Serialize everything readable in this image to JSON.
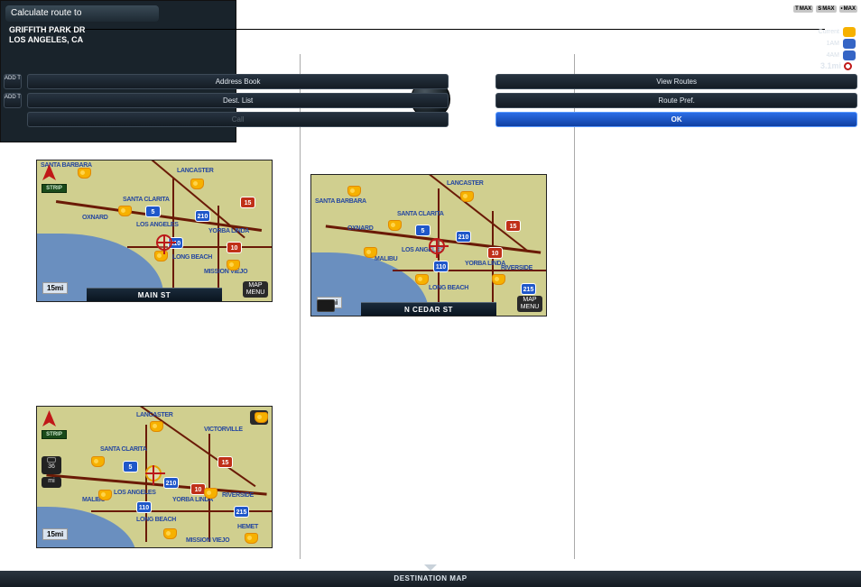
{
  "sep_line": true,
  "mapA": {
    "scale": "15mi",
    "street": "MAIN ST",
    "menu_btn_line1": "MAP",
    "menu_btn_line2": "MENU",
    "strip_label": "STRIP",
    "places": {
      "santa_barbara": "SANTA BARBARA",
      "lancaster": "LANCASTER",
      "santa_clarita": "SANTA CLARITA",
      "los_angeles": "LOS ANGELES",
      "yorba_linda": "YORBA LINDA",
      "long_beach": "LONG BEACH",
      "mission_viejo": "MISSION VIEJO",
      "oxnard": "OXNARD"
    },
    "shields": {
      "a": "5",
      "b": "210",
      "c": "110",
      "d": "10",
      "e": "15"
    }
  },
  "mapB": {
    "scale": "15mi",
    "strip_label": "STRIP",
    "side_distance": "36",
    "side_unit": "mi",
    "places": {
      "lancaster": "LANCASTER",
      "victorville": "VICTORVILLE",
      "santa_clarita": "SANTA CLARITA",
      "los_angeles": "LOS ANGELES",
      "yorba_linda": "YORBA LINDA",
      "long_beach": "LONG BEACH",
      "mission_viejo": "MISSION VIEJO",
      "riverside": "RIVERSIDE",
      "hemet": "HEMET",
      "malibu": "MALIBU"
    },
    "shields": {
      "a": "5",
      "b": "210",
      "c": "110",
      "d": "10",
      "e": "15",
      "f": "215"
    }
  },
  "mapC": {
    "scale": "15mi",
    "street": "N CEDAR ST",
    "menu_btn_line1": "MAP",
    "menu_btn_line2": "MENU",
    "places": {
      "santa_barbara": "SANTA BARBARA",
      "lancaster": "LANCASTER",
      "santa_clarita": "SANTA CLARITA",
      "los_angeles": "LOS ANGELES",
      "yorba_linda": "YORBA LINDA",
      "long_beach": "LONG BEACH",
      "riverside": "RIVERSIDE",
      "oxnard": "OXNARD",
      "malibu": "MALIBU"
    },
    "shields": {
      "a": "5",
      "b": "210",
      "c": "110",
      "d": "10",
      "e": "15",
      "f": "215"
    }
  },
  "nav": {
    "header": "Calculate route to",
    "badges": [
      "MAX",
      "MAX",
      "MAX"
    ],
    "badge_prefix": [
      "T",
      "S",
      "•"
    ],
    "dest_line1": "GRIFFITH PARK DR",
    "dest_line2": "LOS ANGELES, CA",
    "weather_rows": [
      {
        "label": "Current",
        "kind": "sun"
      },
      {
        "label": "1AM",
        "kind": "rain"
      },
      {
        "label": "4AM",
        "kind": "rain"
      }
    ],
    "distance": "3.1mi",
    "buttons": {
      "row1": [
        {
          "prefix": "ADD\nTO",
          "label": "Address Book",
          "kind": "normal"
        },
        {
          "label": "View Routes",
          "kind": "normal"
        }
      ],
      "row2": [
        {
          "prefix": "ADD\nTO",
          "label": "Dest. List",
          "kind": "normal"
        },
        {
          "label": "Route Pref.",
          "kind": "normal"
        }
      ],
      "row3": [
        {
          "prefix": "",
          "label": "Call",
          "kind": "dim"
        },
        {
          "label": "OK",
          "kind": "sel"
        }
      ]
    },
    "footer": "DESTINATION MAP"
  }
}
